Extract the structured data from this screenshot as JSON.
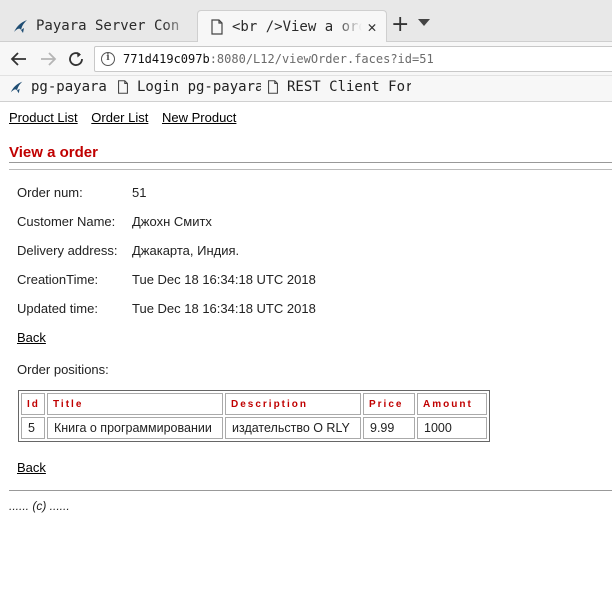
{
  "tabs": [
    {
      "label": "Payara Server Con",
      "icon": "payara-icon"
    },
    {
      "label": "<br />View a order",
      "icon": "document-icon",
      "close": "✕"
    }
  ],
  "tabbar": {
    "new_tab": "+",
    "menu_icon": "chevron-down-icon"
  },
  "nav": {
    "url_host": "771d419c097b",
    "url_rest": ":8080/L12/viewOrder.faces?id=51"
  },
  "bookmarks": [
    {
      "label": "pg-payara",
      "icon": "payara-icon"
    },
    {
      "label": "Login pg-payara",
      "icon": "document-icon"
    },
    {
      "label": "REST Client For",
      "icon": "document-icon"
    }
  ],
  "menu": {
    "product_list": "Product List",
    "order_list": "Order List",
    "new_product": "New Product"
  },
  "page": {
    "title": "View a order",
    "fields": {
      "order_num": {
        "label": "Order num:",
        "value": "51"
      },
      "customer_name": {
        "label": "Customer Name:",
        "value": "Джохн Смитх"
      },
      "delivery_address": {
        "label": "Delivery address:",
        "value": "Джакарта, Индия."
      },
      "creation_time": {
        "label": "CreationTime:",
        "value": "Tue Dec 18 16:34:18 UTC 2018"
      },
      "updated_time": {
        "label": "Updated time:",
        "value": "Tue Dec 18 16:34:18 UTC 2018"
      }
    },
    "back_label": "Back",
    "positions_label": "Order positions:",
    "table": {
      "headers": {
        "id": "Id",
        "title": "Title",
        "description": "Description",
        "price": "Price",
        "amount": "Amount"
      },
      "rows": [
        {
          "id": "5",
          "title": "Книга о программировании",
          "description": "издательство O RLY",
          "price": "9.99",
          "amount": "1000"
        }
      ]
    },
    "footer": "...... (c) ......"
  },
  "colors": {
    "title_red": "#c00000",
    "header_red": "#c00000"
  }
}
